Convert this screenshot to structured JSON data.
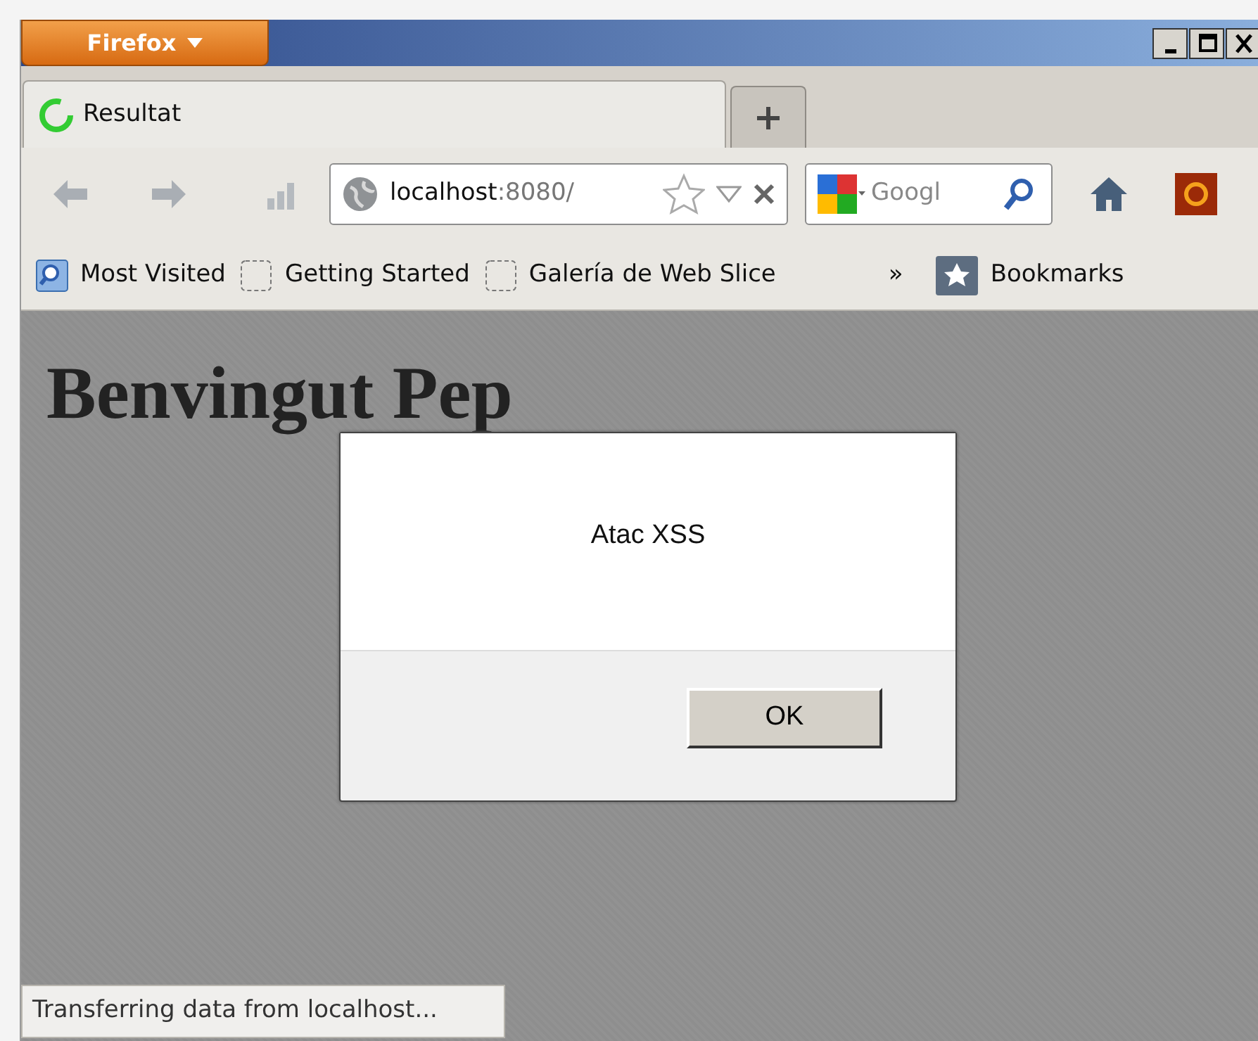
{
  "window": {
    "menu_button": "Firefox"
  },
  "tabs": [
    {
      "label": "Resultat",
      "selected": true
    }
  ],
  "address_bar": {
    "host": "localhost",
    "rest": ":8080/"
  },
  "search": {
    "placeholder": "Googl"
  },
  "bookmarks": [
    {
      "label": "Most Visited",
      "kind": "smart"
    },
    {
      "label": "Getting Started",
      "kind": "page"
    },
    {
      "label": "Galería de Web Slice",
      "kind": "page"
    }
  ],
  "bookmarks_overflow": "»",
  "bookmarks_menu": "Bookmarks",
  "page": {
    "heading": "Benvingut Pep"
  },
  "alert": {
    "message": "Atac XSS",
    "button": "OK"
  },
  "status_bar": "Transferring data from localhost..."
}
